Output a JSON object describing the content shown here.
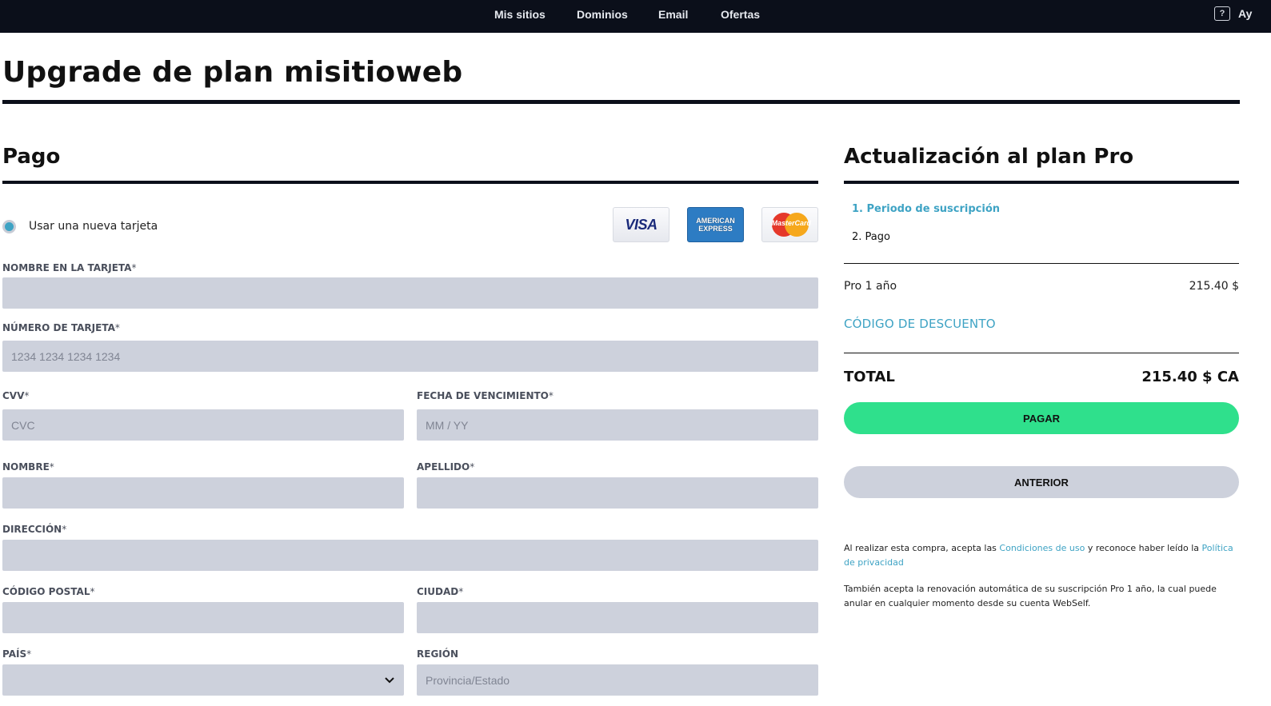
{
  "nav": {
    "items": [
      "Mis sitios",
      "Dominios",
      "Email",
      "Ofertas"
    ],
    "help_icon": "?",
    "help_label": "Ay"
  },
  "page": {
    "title": "Upgrade de plan misitioweb"
  },
  "payment": {
    "heading": "Pago",
    "radio_label": "Usar una nueva tarjeta",
    "cards": [
      "VISA",
      "AMERICAN EXPRESS",
      "MasterCard"
    ],
    "fields": {
      "name_on_card": {
        "label": "NOMBRE EN LA TARJETA",
        "value": ""
      },
      "card_number": {
        "label": "NÚMERO DE TARJETA",
        "placeholder": "1234 1234 1234 1234"
      },
      "cvv": {
        "label": "CVV",
        "placeholder": "CVC"
      },
      "expiry": {
        "label": "FECHA DE VENCIMIENTO",
        "placeholder": "MM / YY"
      },
      "first_name": {
        "label": "NOMBRE",
        "value": ""
      },
      "last_name": {
        "label": "APELLIDO",
        "value": ""
      },
      "address": {
        "label": "DIRECCIÓN",
        "value": ""
      },
      "postal_code": {
        "label": "CÓDIGO POSTAL",
        "value": ""
      },
      "city": {
        "label": "CIUDAD",
        "value": ""
      },
      "country": {
        "label": "PAÍS",
        "value": ""
      },
      "region": {
        "label": "REGIÓN",
        "placeholder": "Provincia/Estado"
      }
    },
    "required_mark": "*"
  },
  "summary": {
    "heading": "Actualización al plan Pro",
    "steps": [
      "1. Periodo de suscripción",
      "2. Pago"
    ],
    "line_item": {
      "label": "Pro 1 año",
      "price": "215.40 $"
    },
    "discount_link": "CÓDIGO DE DESCUENTO",
    "total_label": "TOTAL",
    "total_value": "215.40 $ CA",
    "pay_button": "PAGAR",
    "back_button": "ANTERIOR",
    "legal": {
      "p1_a": "Al realizar esta compra, acepta las ",
      "p1_link1": "Condiciones de uso",
      "p1_b": " y reconoce haber leído la ",
      "p1_link2": "Política de privacidad",
      "p2": "También acepta la renovación automática de su suscripción Pro 1 año, la cual puede anular en cualquier momento desde su cuenta WebSelf."
    }
  },
  "colors": {
    "accent": "#3ea3c4",
    "pay": "#2fe08c",
    "field_bg": "#cdd1dc",
    "nav_bg": "#0b0f1a"
  }
}
